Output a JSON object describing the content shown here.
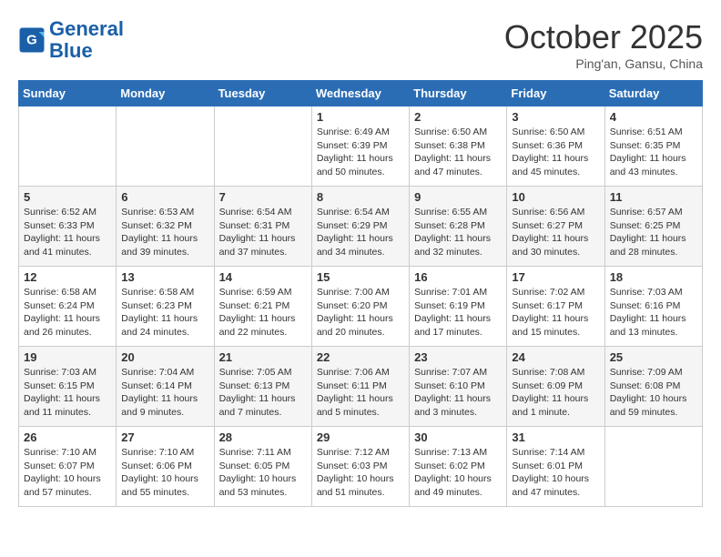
{
  "logo": {
    "line1": "General",
    "line2": "Blue"
  },
  "title": "October 2025",
  "subtitle": "Ping'an, Gansu, China",
  "weekdays": [
    "Sunday",
    "Monday",
    "Tuesday",
    "Wednesday",
    "Thursday",
    "Friday",
    "Saturday"
  ],
  "weeks": [
    [
      {
        "day": "",
        "info": ""
      },
      {
        "day": "",
        "info": ""
      },
      {
        "day": "",
        "info": ""
      },
      {
        "day": "1",
        "info": "Sunrise: 6:49 AM\nSunset: 6:39 PM\nDaylight: 11 hours and 50 minutes."
      },
      {
        "day": "2",
        "info": "Sunrise: 6:50 AM\nSunset: 6:38 PM\nDaylight: 11 hours and 47 minutes."
      },
      {
        "day": "3",
        "info": "Sunrise: 6:50 AM\nSunset: 6:36 PM\nDaylight: 11 hours and 45 minutes."
      },
      {
        "day": "4",
        "info": "Sunrise: 6:51 AM\nSunset: 6:35 PM\nDaylight: 11 hours and 43 minutes."
      }
    ],
    [
      {
        "day": "5",
        "info": "Sunrise: 6:52 AM\nSunset: 6:33 PM\nDaylight: 11 hours and 41 minutes."
      },
      {
        "day": "6",
        "info": "Sunrise: 6:53 AM\nSunset: 6:32 PM\nDaylight: 11 hours and 39 minutes."
      },
      {
        "day": "7",
        "info": "Sunrise: 6:54 AM\nSunset: 6:31 PM\nDaylight: 11 hours and 37 minutes."
      },
      {
        "day": "8",
        "info": "Sunrise: 6:54 AM\nSunset: 6:29 PM\nDaylight: 11 hours and 34 minutes."
      },
      {
        "day": "9",
        "info": "Sunrise: 6:55 AM\nSunset: 6:28 PM\nDaylight: 11 hours and 32 minutes."
      },
      {
        "day": "10",
        "info": "Sunrise: 6:56 AM\nSunset: 6:27 PM\nDaylight: 11 hours and 30 minutes."
      },
      {
        "day": "11",
        "info": "Sunrise: 6:57 AM\nSunset: 6:25 PM\nDaylight: 11 hours and 28 minutes."
      }
    ],
    [
      {
        "day": "12",
        "info": "Sunrise: 6:58 AM\nSunset: 6:24 PM\nDaylight: 11 hours and 26 minutes."
      },
      {
        "day": "13",
        "info": "Sunrise: 6:58 AM\nSunset: 6:23 PM\nDaylight: 11 hours and 24 minutes."
      },
      {
        "day": "14",
        "info": "Sunrise: 6:59 AM\nSunset: 6:21 PM\nDaylight: 11 hours and 22 minutes."
      },
      {
        "day": "15",
        "info": "Sunrise: 7:00 AM\nSunset: 6:20 PM\nDaylight: 11 hours and 20 minutes."
      },
      {
        "day": "16",
        "info": "Sunrise: 7:01 AM\nSunset: 6:19 PM\nDaylight: 11 hours and 17 minutes."
      },
      {
        "day": "17",
        "info": "Sunrise: 7:02 AM\nSunset: 6:17 PM\nDaylight: 11 hours and 15 minutes."
      },
      {
        "day": "18",
        "info": "Sunrise: 7:03 AM\nSunset: 6:16 PM\nDaylight: 11 hours and 13 minutes."
      }
    ],
    [
      {
        "day": "19",
        "info": "Sunrise: 7:03 AM\nSunset: 6:15 PM\nDaylight: 11 hours and 11 minutes."
      },
      {
        "day": "20",
        "info": "Sunrise: 7:04 AM\nSunset: 6:14 PM\nDaylight: 11 hours and 9 minutes."
      },
      {
        "day": "21",
        "info": "Sunrise: 7:05 AM\nSunset: 6:13 PM\nDaylight: 11 hours and 7 minutes."
      },
      {
        "day": "22",
        "info": "Sunrise: 7:06 AM\nSunset: 6:11 PM\nDaylight: 11 hours and 5 minutes."
      },
      {
        "day": "23",
        "info": "Sunrise: 7:07 AM\nSunset: 6:10 PM\nDaylight: 11 hours and 3 minutes."
      },
      {
        "day": "24",
        "info": "Sunrise: 7:08 AM\nSunset: 6:09 PM\nDaylight: 11 hours and 1 minute."
      },
      {
        "day": "25",
        "info": "Sunrise: 7:09 AM\nSunset: 6:08 PM\nDaylight: 10 hours and 59 minutes."
      }
    ],
    [
      {
        "day": "26",
        "info": "Sunrise: 7:10 AM\nSunset: 6:07 PM\nDaylight: 10 hours and 57 minutes."
      },
      {
        "day": "27",
        "info": "Sunrise: 7:10 AM\nSunset: 6:06 PM\nDaylight: 10 hours and 55 minutes."
      },
      {
        "day": "28",
        "info": "Sunrise: 7:11 AM\nSunset: 6:05 PM\nDaylight: 10 hours and 53 minutes."
      },
      {
        "day": "29",
        "info": "Sunrise: 7:12 AM\nSunset: 6:03 PM\nDaylight: 10 hours and 51 minutes."
      },
      {
        "day": "30",
        "info": "Sunrise: 7:13 AM\nSunset: 6:02 PM\nDaylight: 10 hours and 49 minutes."
      },
      {
        "day": "31",
        "info": "Sunrise: 7:14 AM\nSunset: 6:01 PM\nDaylight: 10 hours and 47 minutes."
      },
      {
        "day": "",
        "info": ""
      }
    ]
  ]
}
